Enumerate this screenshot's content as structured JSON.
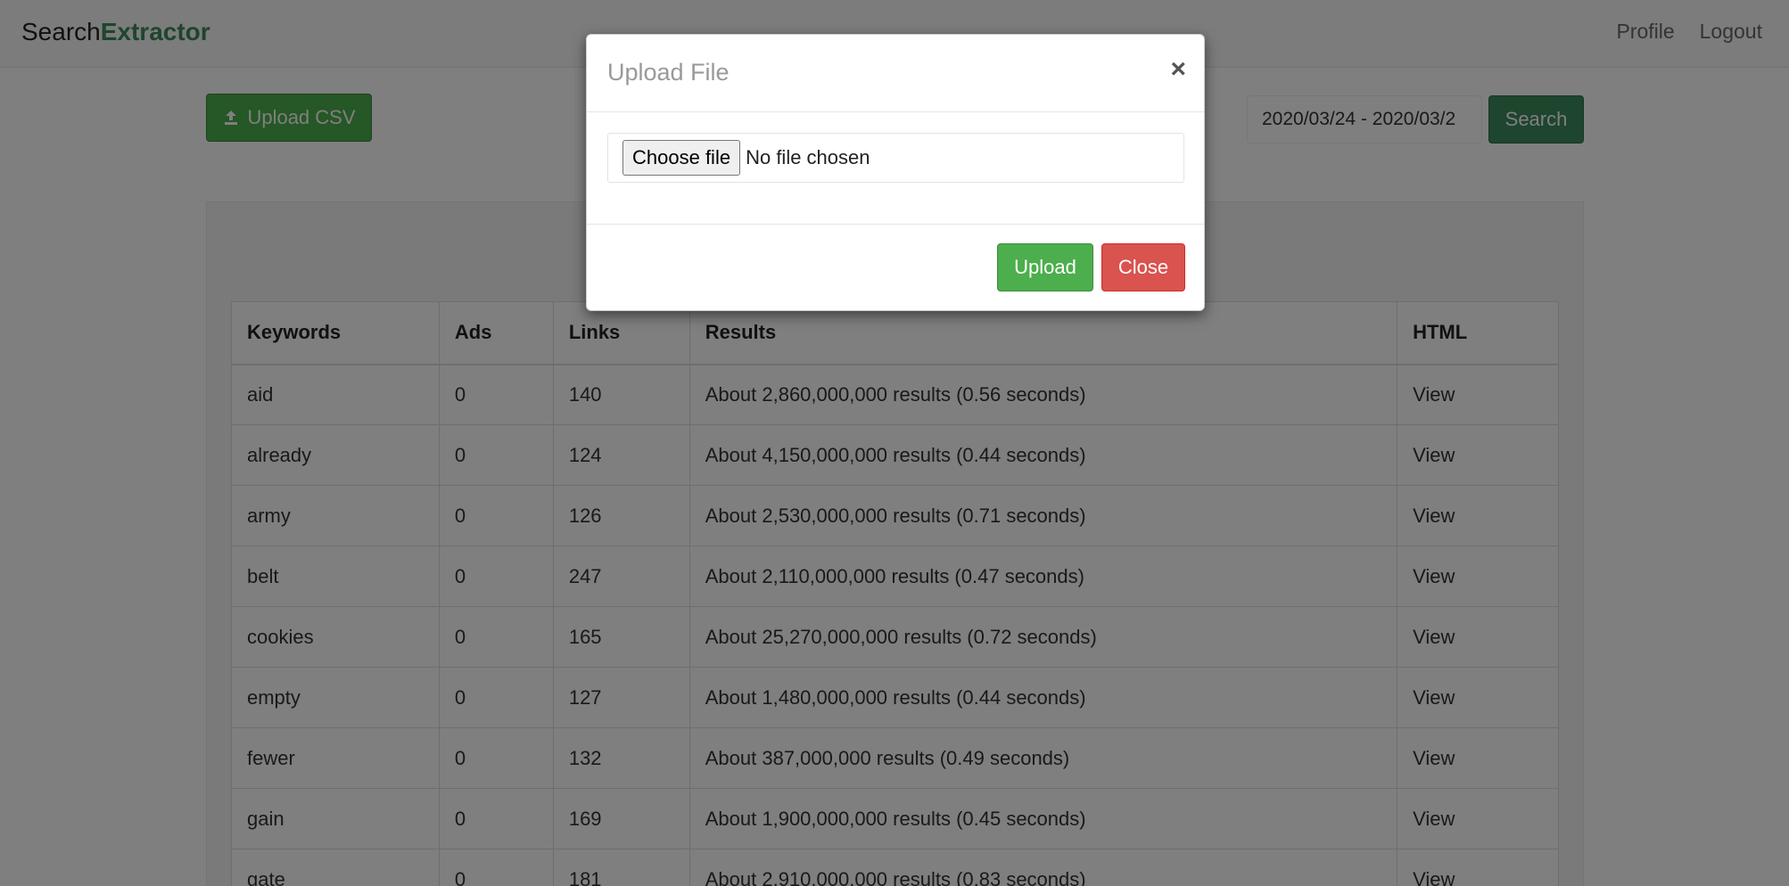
{
  "navbar": {
    "brand_prefix": "Search",
    "brand_accent": "Extractor",
    "links": [
      "Profile",
      "Logout"
    ]
  },
  "toolbar": {
    "upload_csv_label": "Upload CSV",
    "upload_icon": "upload-icon",
    "date_range": "2020/03/24 - 2020/03/2",
    "search_label": "Search"
  },
  "table": {
    "columns": [
      "Keywords",
      "Ads",
      "Links",
      "Results",
      "HTML"
    ],
    "rows": [
      {
        "keyword": "aid",
        "ads": "0",
        "links": "140",
        "results": "About 2,860,000,000 results (0.56 seconds)",
        "html": "View"
      },
      {
        "keyword": "already",
        "ads": "0",
        "links": "124",
        "results": "About 4,150,000,000 results (0.44 seconds)",
        "html": "View"
      },
      {
        "keyword": "army",
        "ads": "0",
        "links": "126",
        "results": "About 2,530,000,000 results (0.71 seconds)",
        "html": "View"
      },
      {
        "keyword": "belt",
        "ads": "0",
        "links": "247",
        "results": "About 2,110,000,000 results (0.47 seconds)",
        "html": "View"
      },
      {
        "keyword": "cookies",
        "ads": "0",
        "links": "165",
        "results": "About 25,270,000,000 results (0.72 seconds)",
        "html": "View"
      },
      {
        "keyword": "empty",
        "ads": "0",
        "links": "127",
        "results": "About 1,480,000,000 results (0.44 seconds)",
        "html": "View"
      },
      {
        "keyword": "fewer",
        "ads": "0",
        "links": "132",
        "results": "About 387,000,000 results (0.49 seconds)",
        "html": "View"
      },
      {
        "keyword": "gain",
        "ads": "0",
        "links": "169",
        "results": "About 1,900,000,000 results (0.45 seconds)",
        "html": "View"
      },
      {
        "keyword": "gate",
        "ads": "0",
        "links": "181",
        "results": "About 2,910,000,000 results (0.83 seconds)",
        "html": "View"
      }
    ]
  },
  "modal": {
    "title": "Upload File",
    "close_symbol": "×",
    "choose_file_label": "Choose file",
    "file_status": "No file chosen",
    "upload_label": "Upload",
    "close_label": "Close"
  },
  "colors": {
    "brand_accent": "#3d8b5a",
    "success": "#4cae4c",
    "danger": "#d9534f",
    "link_muted": "#8a8a8a"
  }
}
